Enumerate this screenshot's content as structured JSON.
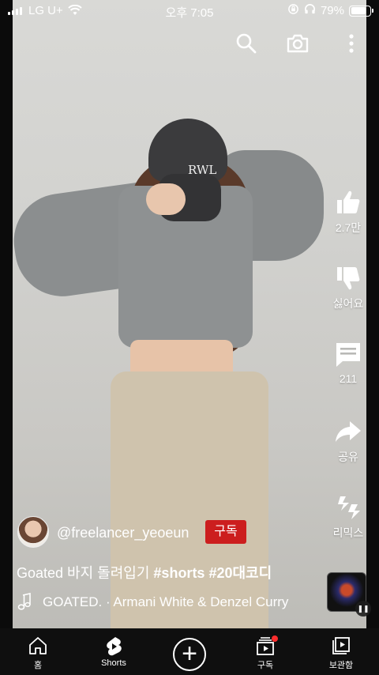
{
  "status_bar": {
    "carrier": "LG U+",
    "time": "오후 7:05",
    "battery": "79%",
    "battery_level": 0.79
  },
  "top_bar": {
    "icons": [
      "search-icon",
      "camera-icon",
      "more-vertical-icon"
    ]
  },
  "actions": {
    "like_count": "2.7만",
    "dislike_label": "싫어요",
    "comment_count": "211",
    "share_label": "공유",
    "remix_label": "리믹스"
  },
  "video": {
    "cap_logo": "RWL",
    "channel": "@freelancer_yeoeun",
    "subscribe_label": "구독",
    "title_plain": "Goated 바지 돌려입기 ",
    "title_tags": "#shorts #20대코디",
    "music": "GOATED. · Armani White & Denzel Curry"
  },
  "nav": {
    "items": [
      {
        "label": "홈",
        "icon": "home-icon"
      },
      {
        "label": "Shorts",
        "icon": "shorts-icon"
      },
      {
        "label": "",
        "icon": "create-icon"
      },
      {
        "label": "구독",
        "icon": "subscriptions-icon"
      },
      {
        "label": "보관함",
        "icon": "library-icon"
      }
    ]
  },
  "colors": {
    "subscribe": "#cc1e1e",
    "nav_bg": "#0f0f0f",
    "notification_dot": "#ff2d2d"
  }
}
